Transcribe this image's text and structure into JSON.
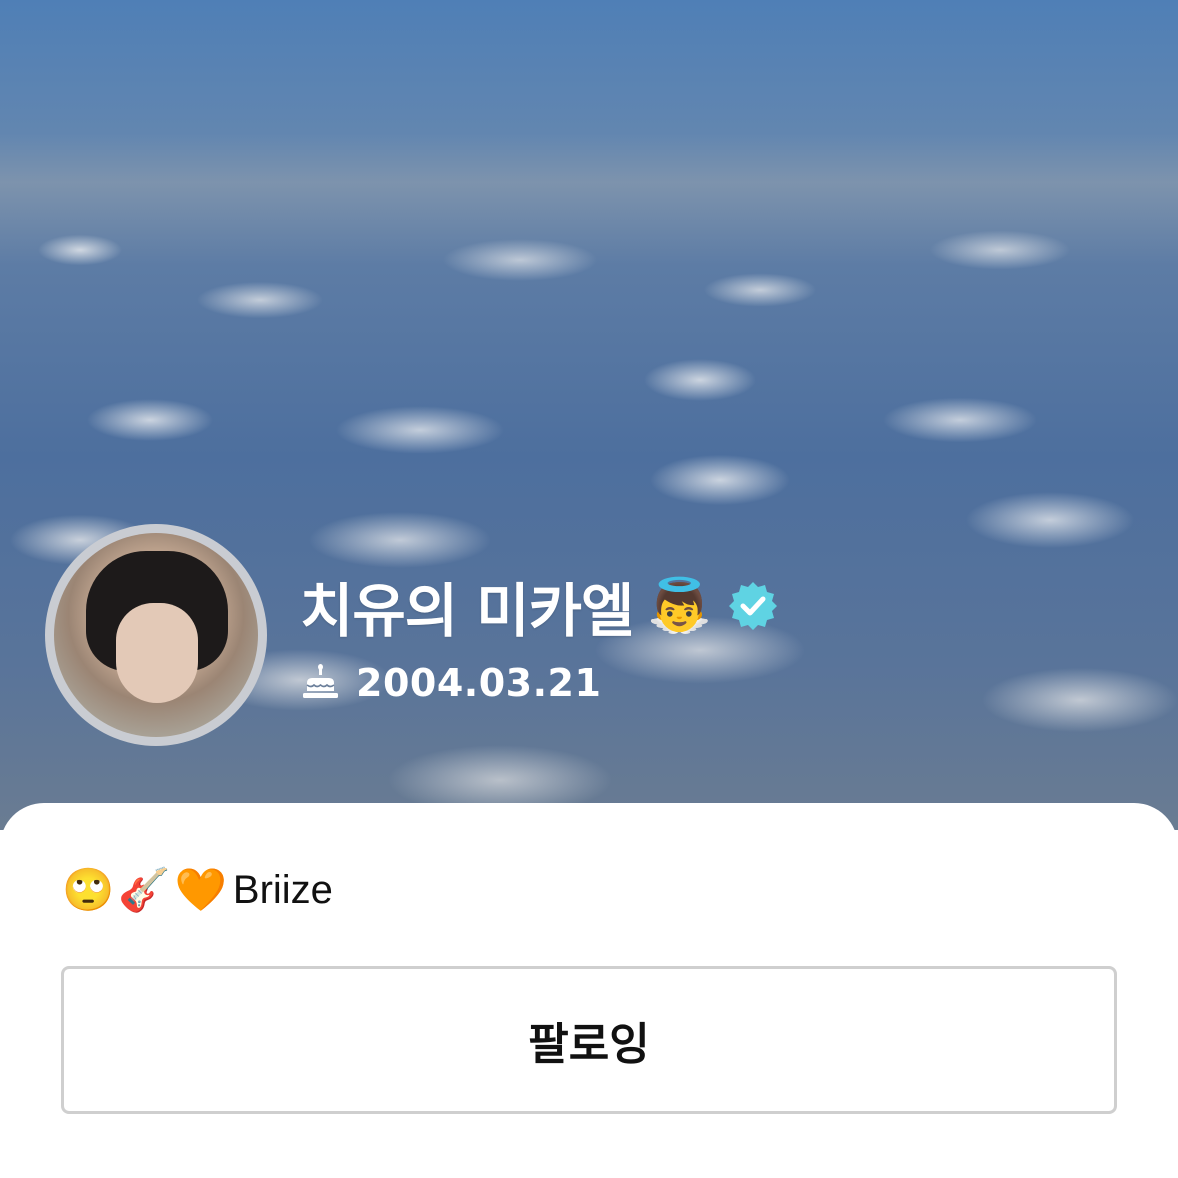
{
  "profile": {
    "display_name": "치유의 미카엘",
    "name_emoji": "👼",
    "verified_icon": "verified-badge-icon",
    "birthday_icon": "cake-icon",
    "birthday": "2004.03.21",
    "bio_emojis": [
      "🙄",
      "🎸",
      "🧡"
    ],
    "bio_text": "Briize"
  },
  "actions": {
    "follow_label": "팔로잉"
  },
  "colors": {
    "verified_badge": "#5fd3e3",
    "button_border": "#cfcfcf",
    "sky": "#4f7fb6"
  }
}
